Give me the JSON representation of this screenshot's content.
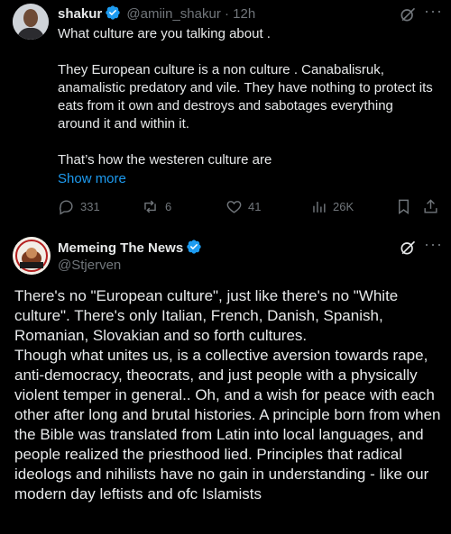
{
  "post1": {
    "display_name": "shakur",
    "handle": "@amiin_shakur",
    "separator": "·",
    "time": "12h",
    "text": "What culture are you talking about .\n\nThey European culture is a non culture . Canabalisruk, anamalistic predatory and vile. They have nothing to protect its eats from it own and destroys and sabotages everything around it and within it.\n\nThat’s how the westeren culture are",
    "show_more": "Show more",
    "replies": "331",
    "reposts": "6",
    "likes": "41",
    "views": "26K",
    "more_label": "···"
  },
  "post2": {
    "display_name": "Memeing The News",
    "handle": "@Stjerven",
    "more_label": "···",
    "text": "There's no \"European culture\", just like there's no \"White culture\". There's only Italian, French, Danish, Spanish, Romanian, Slovakian and so forth cultures.\nThough what unites us, is a collective aversion towards rape, anti-democracy, theocrats, and just people with a physically violent temper in general.. Oh, and a wish for peace with each other after long and brutal histories. A principle born from when the Bible was translated from Latin into local languages, and people realized the priesthood lied. Principles that radical ideologs and nihilists have no gain in understanding - like our modern day leftists and ofc Islamists"
  },
  "colors": {
    "background": "#000000",
    "text": "#e7e9ea",
    "muted": "#71767b",
    "link": "#1d9bf0",
    "verified": "#1d9bf0"
  },
  "icons": [
    "verified-badge-icon",
    "grok-icon",
    "more-icon",
    "reply-icon",
    "repost-icon",
    "like-icon",
    "views-icon",
    "bookmark-icon",
    "share-icon"
  ]
}
